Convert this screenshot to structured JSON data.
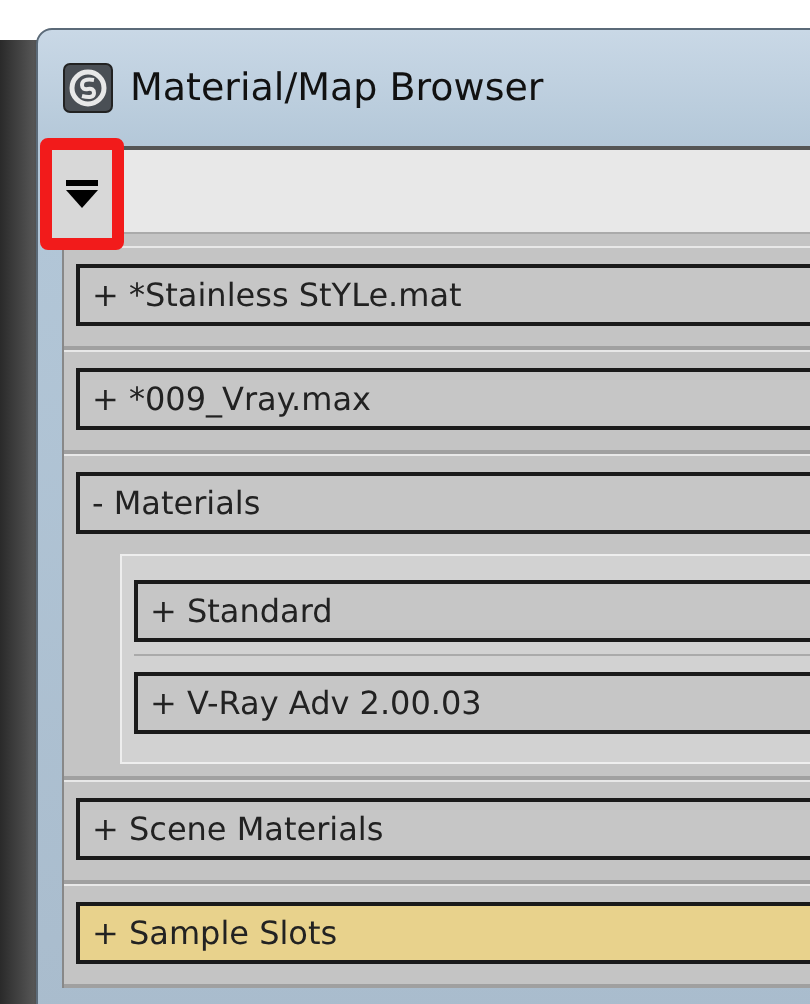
{
  "window": {
    "title": "Material/Map Browser"
  },
  "toolbar": {
    "menu_button": {
      "highlighted": true
    }
  },
  "groups": [
    {
      "sign": "+",
      "label": "*Stainless StYLe.mat",
      "selected": false
    },
    {
      "sign": "+",
      "label": "*009_Vray.max",
      "selected": false
    },
    {
      "sign": "-",
      "label": "Materials",
      "selected": false,
      "children": [
        {
          "sign": "+",
          "label": "Standard",
          "selected": false
        },
        {
          "sign": "+",
          "label": "V-Ray Adv 2.00.03",
          "selected": false
        }
      ]
    },
    {
      "sign": "+",
      "label": "Scene Materials",
      "selected": false
    },
    {
      "sign": "+",
      "label": "Sample Slots",
      "selected": true
    }
  ]
}
